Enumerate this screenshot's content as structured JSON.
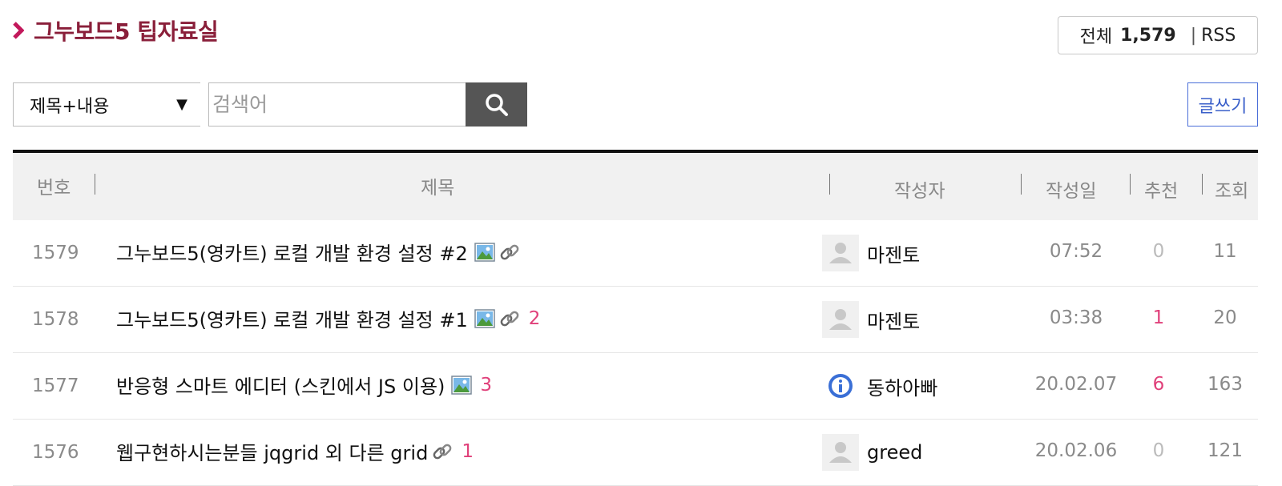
{
  "board": {
    "title": "그누보드5 팁자료실"
  },
  "summary": {
    "total_label": "전체",
    "total_count": "1,579",
    "rss_label": "RSS"
  },
  "search": {
    "field_selected": "제목+내용",
    "placeholder": "검색어",
    "search_icon": "search-icon"
  },
  "write_label": "글쓰기",
  "columns": {
    "num": "번호",
    "subject": "제목",
    "author": "작성자",
    "date": "작성일",
    "recommend": "추천",
    "views": "조회"
  },
  "rows": [
    {
      "num": "1579",
      "subject": "그누보드5(영카트) 로컬 개발 환경 설정 #2",
      "has_image": true,
      "has_link": true,
      "comments": "",
      "author": "마젠토",
      "avatar": "default-avatar",
      "date": "07:52",
      "recommend": "0",
      "views": "11"
    },
    {
      "num": "1578",
      "subject": "그누보드5(영카트) 로컬 개발 환경 설정 #1",
      "has_image": true,
      "has_link": true,
      "comments": "2",
      "author": "마젠토",
      "avatar": "default-avatar",
      "date": "03:38",
      "recommend": "1",
      "views": "20"
    },
    {
      "num": "1577",
      "subject": "반응형 스마트 에디터 (스킨에서 JS 이용)",
      "has_image": true,
      "has_link": false,
      "comments": "3",
      "author": "동하아빠",
      "avatar": "info-avatar",
      "date": "20.02.07",
      "recommend": "6",
      "views": "163"
    },
    {
      "num": "1576",
      "subject": "웹구현하시는분들 jqgrid 외 다른 grid",
      "has_image": false,
      "has_link": true,
      "comments": "1",
      "author": "greed",
      "avatar": "default-avatar",
      "date": "20.02.06",
      "recommend": "0",
      "views": "121"
    }
  ],
  "colors": {
    "title": "#8a1f3a",
    "accent": "#e0407a",
    "write_button": "#3a5fc9",
    "search_button": "#555555"
  }
}
